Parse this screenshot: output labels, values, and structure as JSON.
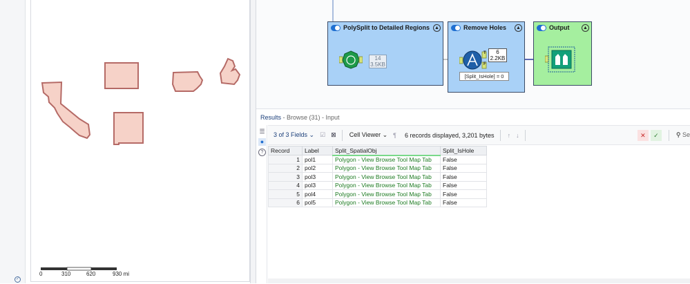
{
  "map": {
    "scale_labels": [
      "0",
      "310",
      "620",
      "930 mi"
    ]
  },
  "canvas": {
    "tools": [
      {
        "title": "PolySplit to Detailed Regions",
        "badge_lines": [
          "14",
          "3.5KB"
        ]
      },
      {
        "title": "Remove Holes",
        "badge_lines": [
          "6",
          "2.2KB"
        ],
        "expression": "[Split_IsHole] = 0",
        "anchor_true": "T",
        "anchor_false": "F"
      },
      {
        "title": "Output"
      }
    ]
  },
  "results": {
    "title": "Results",
    "subtitle": "- Browse (31) - Input",
    "toolbar": {
      "fields_label": "3 of 3 Fields",
      "viewer_label": "Cell Viewer",
      "records_label": "6 records displayed, 3,201 bytes",
      "search_placeholder": "Se"
    },
    "columns": [
      "Record",
      "Label",
      "Split_SpatialObj",
      "Split_IsHole"
    ],
    "rows": [
      [
        "1",
        "pol1",
        "Polygon - View Browse Tool Map Tab",
        "False"
      ],
      [
        "2",
        "pol2",
        "Polygon - View Browse Tool Map Tab",
        "False"
      ],
      [
        "3",
        "pol3",
        "Polygon - View Browse Tool Map Tab",
        "False"
      ],
      [
        "4",
        "pol3",
        "Polygon - View Browse Tool Map Tab",
        "False"
      ],
      [
        "5",
        "pol4",
        "Polygon - View Browse Tool Map Tab",
        "False"
      ],
      [
        "6",
        "pol5",
        "Polygon - View Browse Tool Map Tab",
        "False"
      ]
    ]
  },
  "colors": {
    "tool_blue": "#a9d1f7",
    "tool_green": "#a5ef9f",
    "polygon_fill": "#f6d2c8",
    "polygon_stroke": "#b56a66",
    "accent": "#1f6fd1"
  }
}
